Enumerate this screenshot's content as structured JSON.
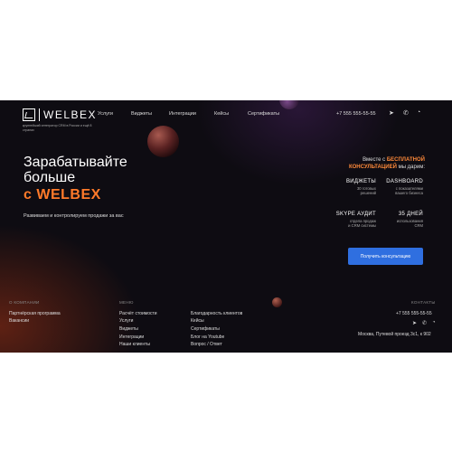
{
  "logo": {
    "text": "WELBEX",
    "tagline": "крупнейший интегратор CRM в России и ещё 8 странах"
  },
  "nav": [
    "Услуги",
    "Виджеты",
    "Интеграции",
    "Кейсы",
    "Сертификаты"
  ],
  "header": {
    "phone": "+7 555 555-55-55",
    "icons": [
      "telegram-icon",
      "viber-icon",
      "whatsapp-icon"
    ]
  },
  "hero": {
    "title_line1": "Зарабатывайте",
    "title_line2": "больше",
    "title_brand": "с WELBEX",
    "subtitle": "Развиваем и контролируем продажи за вас"
  },
  "promo": {
    "line1_pre": "Вместе с ",
    "line1_hl": "БЕСПЛАТНОЙ",
    "line2_hl": "КОНСУЛЬТАЦИЕЙ",
    "line2_post": " мы дарим:",
    "features": [
      {
        "title": "ВИДЖЕТЫ",
        "desc1": "30 готовых",
        "desc2": "решений"
      },
      {
        "title": "DASHBOARD",
        "desc1": "с показателями",
        "desc2": "вашего бизнеса"
      },
      {
        "title": "SKYPE АУДИТ",
        "desc1": "отдела продаж",
        "desc2": "и CRM системы"
      },
      {
        "title": "35 ДНЕЙ",
        "desc1": "использования",
        "desc2": "CRM"
      }
    ],
    "cta": "Получить консультацию"
  },
  "footer": {
    "company": {
      "heading": "О КОМПАНИИ",
      "items": [
        "Партнёрская программа",
        "Вакансии"
      ]
    },
    "menu": {
      "heading": "МЕНЮ",
      "col1": [
        "Расчёт стоимости",
        "Услуги",
        "Виджеты",
        "Интеграции",
        "Наши клиенты"
      ],
      "col2": [
        "Благодарность клиентов",
        "Кейсы",
        "Сертификаты",
        "Блог на Youtube",
        "Вопрос / Ответ"
      ]
    },
    "contacts": {
      "heading": "КОНТАКТЫ",
      "phone": "+7 555 555-55-55",
      "address": "Москва, Путевой проезд 3с1, к 902"
    }
  },
  "colors": {
    "accent": "#ff7a2a",
    "button": "#2f6fe0",
    "background": "#0e0c12"
  }
}
